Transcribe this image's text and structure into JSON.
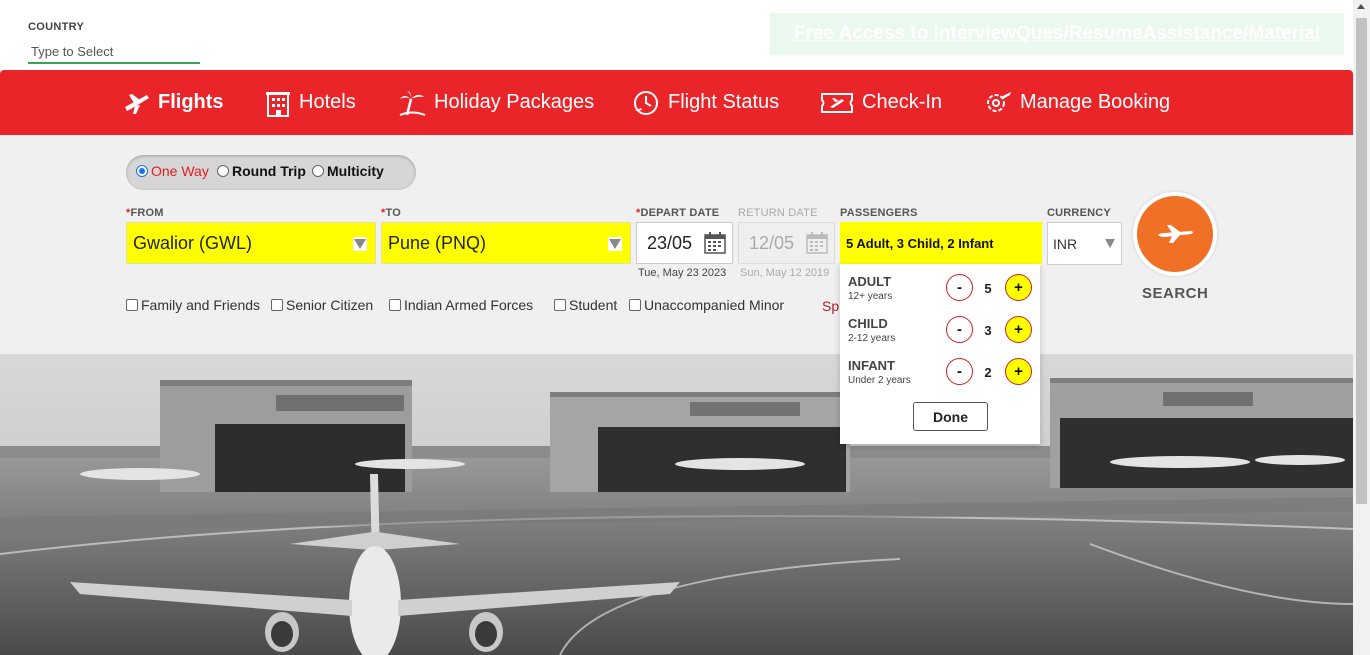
{
  "country": {
    "label": "COUNTRY",
    "placeholder": "Type to Select"
  },
  "promo": {
    "text": "Free Access to InterviewQues/ResumeAssistance/Material"
  },
  "nav": {
    "items": [
      {
        "label": "Flights",
        "icon": "plane-icon",
        "active": true
      },
      {
        "label": "Hotels",
        "icon": "building-icon"
      },
      {
        "label": "Holiday Packages",
        "icon": "palm-tree-icon"
      },
      {
        "label": "Flight Status",
        "icon": "clock-plane-icon"
      },
      {
        "label": "Check-In",
        "icon": "ticket-icon"
      },
      {
        "label": "Manage Booking",
        "icon": "gear-plane-icon"
      }
    ]
  },
  "trip_types": [
    {
      "label": "One Way",
      "selected": true
    },
    {
      "label": "Round Trip",
      "selected": false
    },
    {
      "label": "Multicity",
      "selected": false
    }
  ],
  "from": {
    "label": "FROM",
    "value": "Gwalior (GWL)"
  },
  "to": {
    "label": "TO",
    "value": "Pune (PNQ)"
  },
  "depart": {
    "label": "DEPART DATE",
    "value": "23/05",
    "sub": "Tue, May 23 2023"
  },
  "return": {
    "label": "RETURN DATE",
    "value": "12/05",
    "sub": "Sun, May 12 2019"
  },
  "passengers": {
    "label": "PASSENGERS",
    "value": "5 Adult, 3 Child, 2 Infant",
    "rows": [
      {
        "title": "ADULT",
        "sub": "12+ years",
        "count": "5"
      },
      {
        "title": "CHILD",
        "sub": "2-12 years",
        "count": "3"
      },
      {
        "title": "INFANT",
        "sub": "Under 2 years",
        "count": "2"
      }
    ],
    "minus": "-",
    "plus": "+",
    "done": "Done"
  },
  "currency": {
    "label": "CURRENCY",
    "value": "INR"
  },
  "search": {
    "label": "SEARCH"
  },
  "options": [
    "Family and Friends",
    "Senior Citizen",
    "Indian Armed Forces",
    "Student",
    "Unaccompanied Minor"
  ],
  "special_partial": "Sp",
  "colors": {
    "brand_red": "#e9252a",
    "highlight_yellow": "#ffff00",
    "search_orange": "#f07025"
  }
}
